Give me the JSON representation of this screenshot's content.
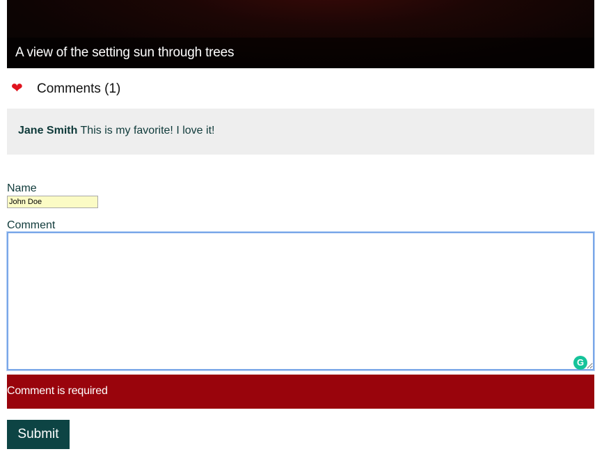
{
  "hero": {
    "caption": "A view of the setting sun through trees"
  },
  "comments": {
    "icon": "heart-icon",
    "heading": "Comments (1)",
    "items": [
      {
        "author": "Jane Smith",
        "text": "This is my favorite! I love it!"
      }
    ]
  },
  "form": {
    "name_label": "Name",
    "name_value": "John Doe",
    "comment_label": "Comment",
    "comment_value": "",
    "error_message": "Comment is required",
    "submit_label": "Submit"
  },
  "colors": {
    "heart": "#e0141e",
    "error_bg": "#99040c",
    "submit_bg": "#0d4444",
    "comment_bg": "#eeeeee",
    "name_input_bg": "#fbfbc5"
  }
}
